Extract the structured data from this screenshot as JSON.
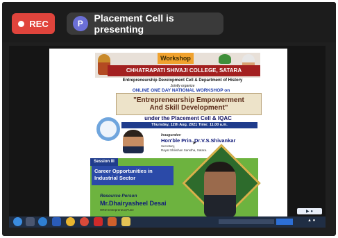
{
  "topbar": {
    "rec_label": "REC",
    "presenter_initial": "P",
    "presenting_text": "Placement Cell is presenting"
  },
  "slide": {
    "workshop_label": "Workshop",
    "college_name": "CHHATRAPATI SHIVAJI COLLEGE, SATARA",
    "organizer_line": "Entrepreneurship Development Cell & Department of History",
    "jointly_label": "Jointly organize",
    "workshop_type": "ONLINE ONE DAY NATIONAL WORKSHOP on",
    "title_line1": "\"Entrepreneurship Empowerment",
    "title_line2": "And Skill Development\"",
    "under_line": "under the Placement Cell & IQAC",
    "date_line": "Thursday, 12th Aug. 2021 Time: 11.00 a.m.",
    "inaugurator_label": "Inaugurator:",
    "inaugurator_name": "Hon'ble Prin. Dr.V.S.Shivankar",
    "inaugurator_designation": "Secretary,",
    "inaugurator_org": "Rayat Shikshan Sanstha, Satara.",
    "session_tag": "Session III",
    "session_title_line1": "Career Opportunities in",
    "session_title_line2": "Industrial Sector",
    "resource_label": "Resource Person",
    "resource_name": "Mr.Dhairyasheel Desai",
    "resource_org": "HRD Entrepreneur,Pune"
  },
  "colors": {
    "rec_red": "#e0443c",
    "avatar_purple": "#6b6fd6",
    "session_green": "#6db33f",
    "session_blue": "#2b4aa8",
    "college_red": "#a32020"
  },
  "taskbar": {
    "icons": [
      "windows-start-icon",
      "app-icon",
      "browser-icon",
      "word-icon",
      "chrome-icon",
      "chrome-icon-2",
      "pdf-icon",
      "powerpoint-icon",
      "folder-icon"
    ]
  }
}
